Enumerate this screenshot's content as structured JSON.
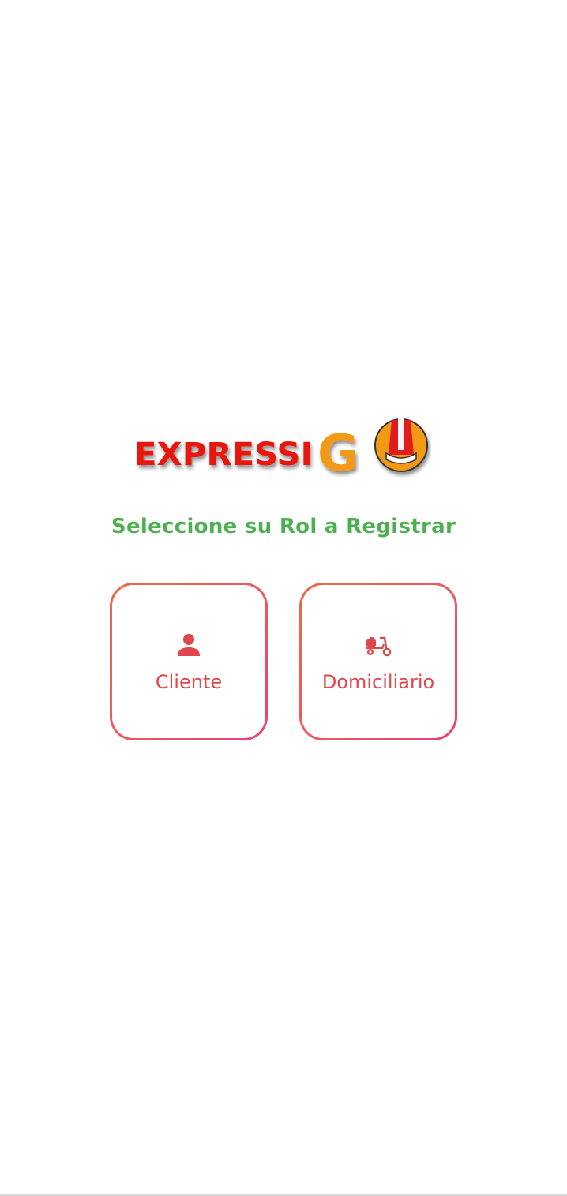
{
  "logo": {
    "text_main": "EXPRESSI",
    "text_accent": "G",
    "main_color": "#e8140f",
    "accent_color": "#f29a14",
    "helmet_red": "#e21b1b"
  },
  "title": "Seleccione su Rol a Registrar",
  "title_color": "#4caf50",
  "roles": [
    {
      "label": "Cliente",
      "icon": "person-icon"
    },
    {
      "label": "Domiciliario",
      "icon": "scooter-icon"
    }
  ],
  "accent_color": "#e0464b"
}
